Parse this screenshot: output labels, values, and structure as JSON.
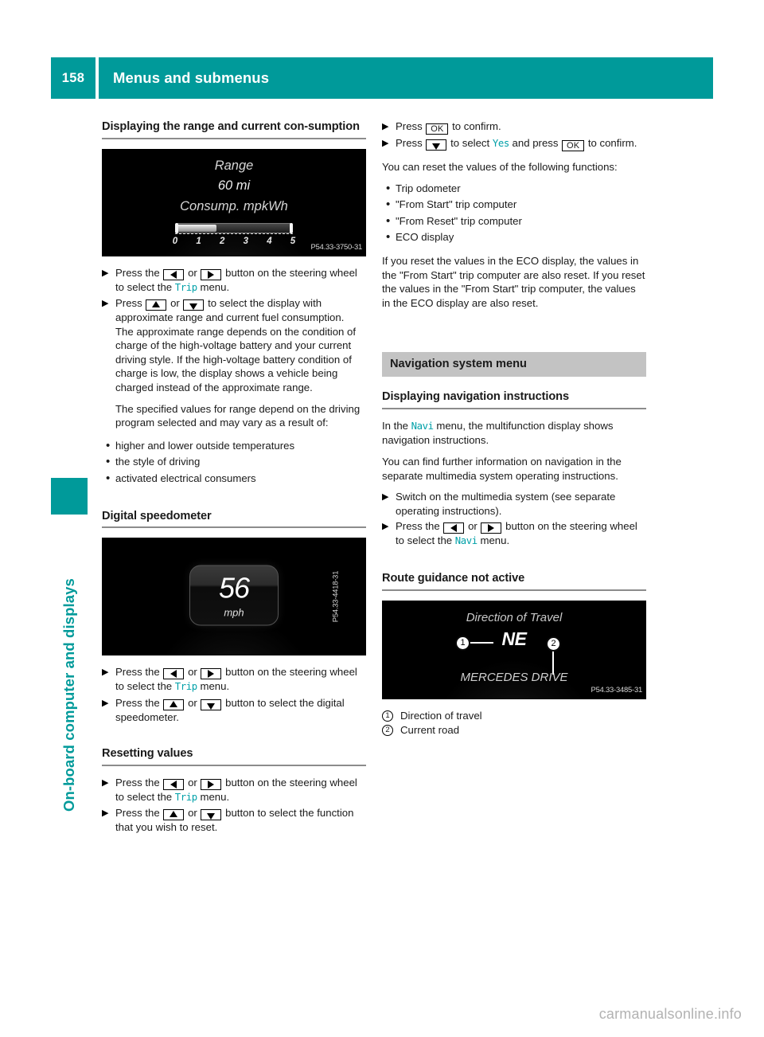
{
  "header": {
    "page_number": "158",
    "title": "Menus and submenus"
  },
  "side_tab": {
    "label": "On-board computer and displays",
    "color": "#009a9a"
  },
  "left_column": {
    "heading_1": "Displaying the range and current con-sumption",
    "figure_range": {
      "title": "Range",
      "value": "60 mi",
      "consumption_label": "Consump. mpkWh",
      "gauge_value": 1.8,
      "gauge_max": 5,
      "ticks": [
        "0",
        "1",
        "2",
        "3",
        "4",
        "5"
      ],
      "code": "P54.33-3750-31"
    },
    "step_1_a": "Press the",
    "step_1_or": "or",
    "step_1_b": "button on the steering wheel to select the",
    "step_1_menu": "Trip",
    "step_1_c": "menu.",
    "step_2_a": "Press",
    "step_2_or": "or",
    "step_2_b": "to select the display with approximate range and current fuel consumption.",
    "step_2_note_1": "The approximate range depends on the condition of charge of the high-voltage battery and your current driving style. If the high-voltage battery condition of charge is low, the display shows a vehicle being charged instead of the approximate range.",
    "step_2_note_2": "The specified values for range depend on the driving program selected and may vary as a result of:",
    "bullets": [
      "higher and lower outside temperatures",
      "the style of driving",
      "activated electrical consumers"
    ],
    "heading_2": "Digital speedometer",
    "figure_speedo": {
      "speed": "56",
      "unit": "mph",
      "code": "P54.33-4418-31"
    },
    "speedo_step_1_a": "Press the",
    "speedo_step_1_or": "or",
    "speedo_step_1_b": "button on the steering wheel to select the",
    "speedo_step_1_menu": "Trip",
    "speedo_step_1_c": "menu.",
    "speedo_step_2_a": "Press the",
    "speedo_step_2_or": "or",
    "speedo_step_2_b": "button to select the digital speedometer.",
    "heading_3": "Resetting values",
    "reset_step_1_a": "Press the",
    "reset_step_1_or": "or",
    "reset_step_1_b": "button on the steering wheel to select the",
    "reset_step_1_menu": "Trip",
    "reset_step_1_c": "menu.",
    "reset_step_2_a": "Press the",
    "reset_step_2_or": "or",
    "reset_step_2_b": "button to select the function that you wish to reset."
  },
  "right_column": {
    "step_1_a": "Press",
    "step_1_b": "to confirm.",
    "step_2_a": "Press",
    "step_2_b": "to select",
    "step_2_yes": "Yes",
    "step_2_c": "and press",
    "step_2_d": "to confirm.",
    "reset_intro": "You can reset the values of the following functions:",
    "bullets": [
      "Trip odometer",
      "\"From Start\" trip computer",
      "\"From Reset\" trip computer",
      "ECO display"
    ],
    "eco_note": "If you reset the values in the ECO display, the values in the \"From Start\" trip computer are also reset. If you reset the values in the \"From Start\" trip computer, the values in the ECO display are also reset.",
    "banner_heading": "Navigation system menu",
    "heading_nav": "Displaying navigation instructions",
    "nav_para_1_a": "In the",
    "nav_para_1_menu": "Navi",
    "nav_para_1_b": "menu, the multifunction display shows navigation instructions.",
    "nav_para_2": "You can find further information on navigation in the separate multimedia system operating instructions.",
    "nav_step_1": "Switch on the multimedia system (see separate operating instructions).",
    "nav_step_2_a": "Press the",
    "nav_step_2_or": "or",
    "nav_step_2_b": "button on the steering wheel to select the",
    "nav_step_2_menu": "Navi",
    "nav_step_2_c": "menu.",
    "heading_route": "Route guidance not active",
    "figure_nav": {
      "header_text": "Direction of Travel",
      "direction": "NE",
      "road": "MERCEDES DRIVE",
      "marker_1": "1",
      "marker_2": "2",
      "code": "P54.33-3485-31"
    },
    "callouts": [
      {
        "num": "1",
        "text": "Direction of travel"
      },
      {
        "num": "2",
        "text": "Current road"
      }
    ]
  },
  "keys": {
    "ok": "OK"
  },
  "watermark": "carmanualsonline.info",
  "colors": {
    "teal": "#009a9a",
    "menu_text": "#00a0a8",
    "banner_gray": "#c3c3c3",
    "rule_gray": "#8c8c8c"
  }
}
